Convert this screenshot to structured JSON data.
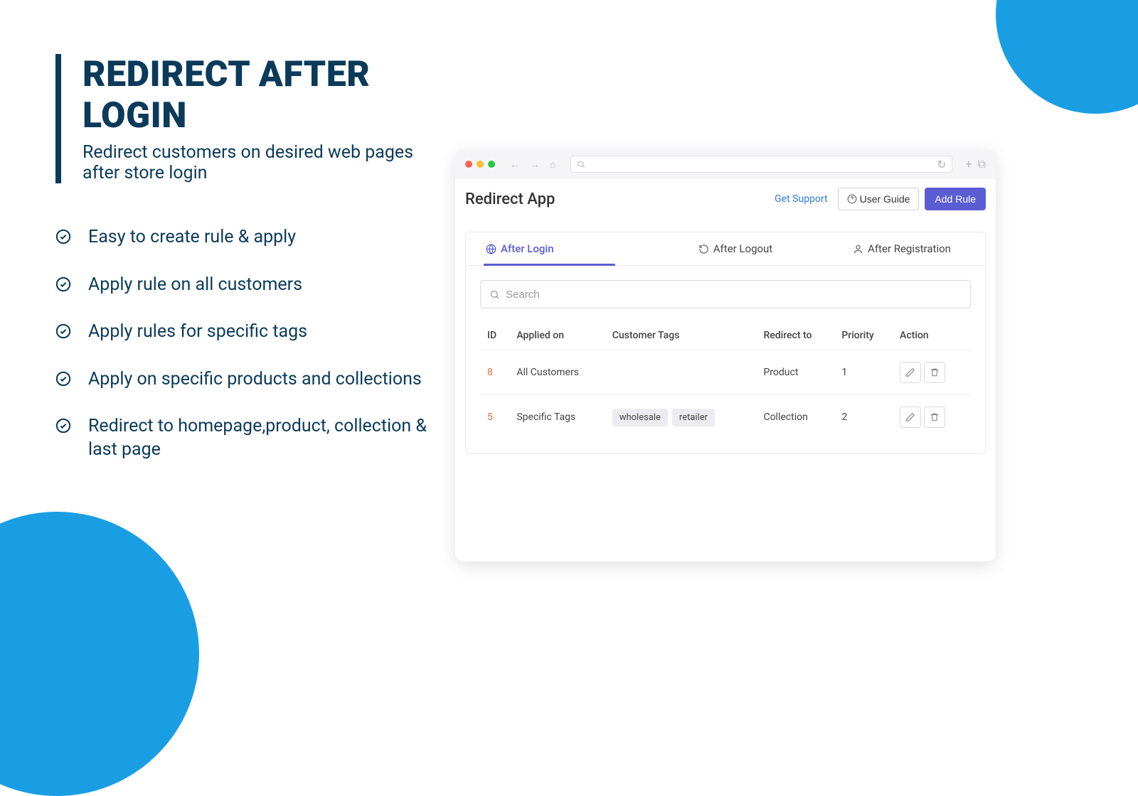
{
  "hero": {
    "title": "REDIRECT AFTER LOGIN",
    "subtitle": "Redirect customers on desired web pages after store login"
  },
  "features": [
    "Easy to create rule & apply",
    "Apply rule on all customers",
    "Apply rules for specific tags",
    "Apply on specific products and collections",
    "Redirect to homepage,product, collection & last page"
  ],
  "app": {
    "title": "Redirect App",
    "support": "Get Support",
    "user_guide": "User Guide",
    "add_rule": "Add Rule",
    "tabs": {
      "after_login": "After Login",
      "after_logout": "After Logout",
      "after_registration": "After Registration"
    },
    "search_placeholder": "Search",
    "columns": {
      "id": "ID",
      "applied_on": "Applied on",
      "customer_tags": "Customer Tags",
      "redirect_to": "Redirect to",
      "priority": "Priority",
      "action": "Action"
    },
    "rows": [
      {
        "id": "8",
        "applied_on": "All Customers",
        "tags": [],
        "redirect_to": "Product",
        "priority": "1"
      },
      {
        "id": "5",
        "applied_on": "Specific Tags",
        "tags": [
          "wholesale",
          "retailer"
        ],
        "redirect_to": "Collection",
        "priority": "2"
      }
    ]
  }
}
